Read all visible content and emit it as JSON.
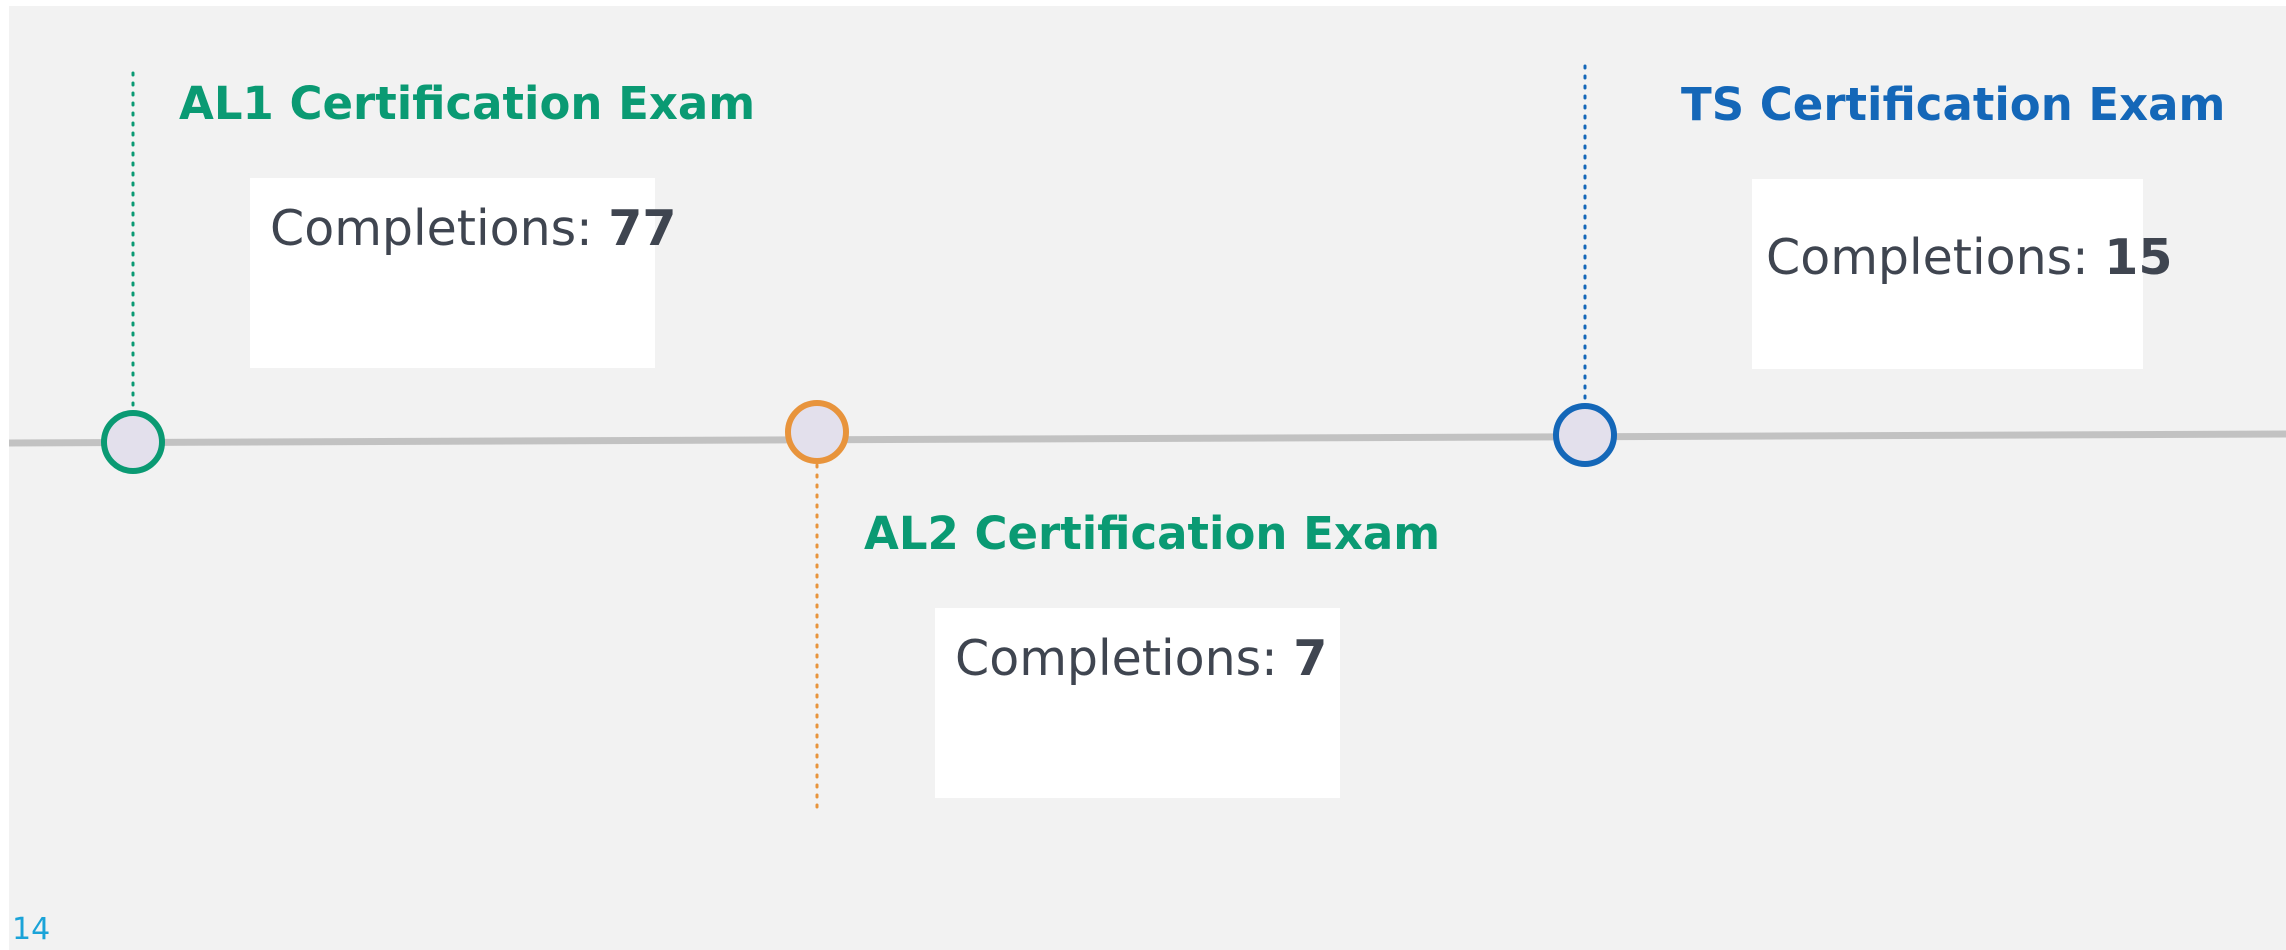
{
  "colors": {
    "green": "#0a9a73",
    "orange": "#e8943c",
    "blue": "#1467b8",
    "timeline": "#c2c2c2",
    "node_fill": "#e3e0ec",
    "slide_bg": "#f2f2f2",
    "text": "#3f4550",
    "page_number": "#1aa3d8"
  },
  "milestones": [
    {
      "id": "al1",
      "title": "AL1 Certification Exam",
      "completions_label": "Completions:",
      "completions_value": "77",
      "color_key": "green"
    },
    {
      "id": "al2",
      "title": "AL2 Certification Exam",
      "completions_label": "Completions:",
      "completions_value": "7",
      "color_key": "green"
    },
    {
      "id": "ts",
      "title": "TS Certification Exam",
      "completions_label": "Completions:",
      "completions_value": "15",
      "color_key": "blue"
    }
  ],
  "node_colors": [
    "green",
    "orange",
    "blue"
  ],
  "page_number": "14"
}
